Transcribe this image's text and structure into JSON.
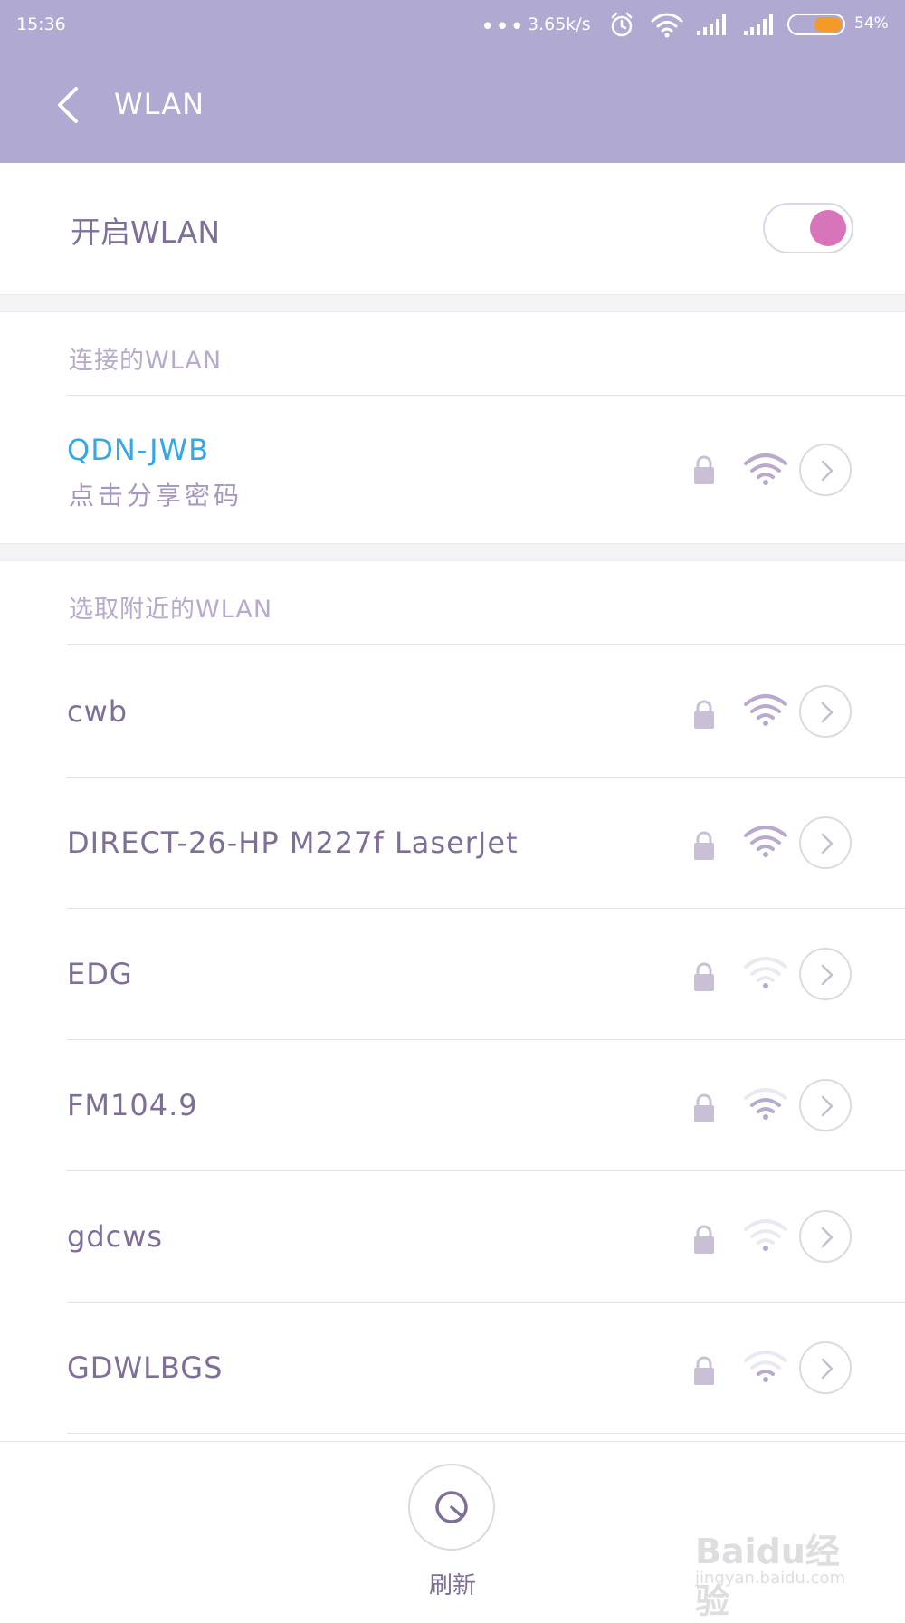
{
  "status_bar": {
    "time": "15:36",
    "more": "•••",
    "speed": "3.65k/s",
    "battery_percent": "54%",
    "battery_level": 0.54
  },
  "header": {
    "title": "WLAN"
  },
  "toggle": {
    "label": "开启WLAN",
    "on": true
  },
  "connected": {
    "section_title": "连接的WLAN",
    "name": "QDN-JWB",
    "subtitle": "点击分享密码"
  },
  "nearby": {
    "section_title": "选取附近的WLAN",
    "networks": [
      {
        "name": "cwb",
        "signal": 4
      },
      {
        "name": "DIRECT-26-HP M227f LaserJet",
        "signal": 4
      },
      {
        "name": "EDG",
        "signal": 1
      },
      {
        "name": "FM104.9",
        "signal": 3
      },
      {
        "name": "gdcws",
        "signal": 1
      },
      {
        "name": "GDWLBGS",
        "signal": 2
      }
    ]
  },
  "bottom": {
    "refresh_label": "刷新"
  },
  "watermark": {
    "brand": "Baidu经验",
    "url": "jingyan.baidu.com"
  },
  "colors": {
    "header_bg": "#b0a9d2",
    "accent_pink": "#d874b9",
    "connected_blue": "#37a6e4",
    "text_purple": "#7f6f98",
    "battery_orange": "#f39b26"
  }
}
